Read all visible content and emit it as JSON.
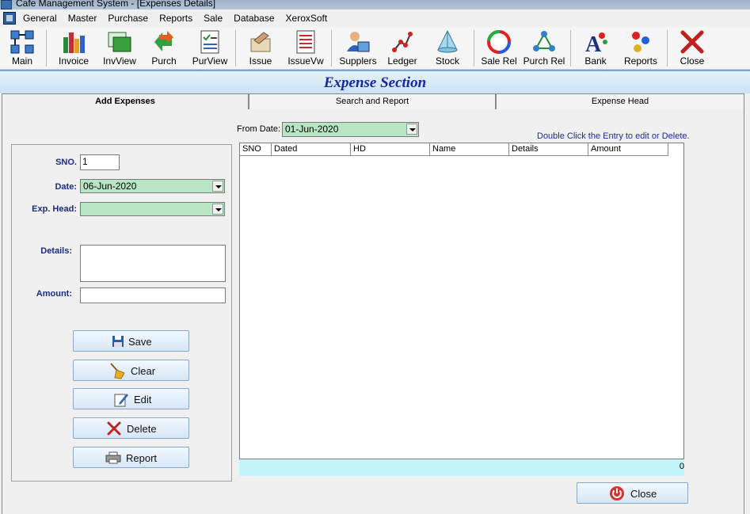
{
  "window": {
    "title": "Cafe Management System - [Expenses Details]"
  },
  "menu": [
    "General",
    "Master",
    "Purchase",
    "Reports",
    "Sale",
    "Database",
    "XeroxSoft"
  ],
  "toolbar": [
    {
      "label": "Main",
      "icon": "main-icon"
    },
    {
      "label": "Invoice",
      "icon": "invoice-icon"
    },
    {
      "label": "InvView",
      "icon": "invview-icon"
    },
    {
      "label": "Purch",
      "icon": "purch-icon"
    },
    {
      "label": "PurView",
      "icon": "purview-icon"
    },
    {
      "label": "Issue",
      "icon": "issue-icon"
    },
    {
      "label": "IssueVw",
      "icon": "issuevw-icon"
    },
    {
      "label": "Supplers",
      "icon": "supplers-icon"
    },
    {
      "label": "Ledger",
      "icon": "ledger-icon"
    },
    {
      "label": "Stock",
      "icon": "stock-icon"
    },
    {
      "label": "Sale Rel",
      "icon": "sale-rel-icon"
    },
    {
      "label": "Purch Rel",
      "icon": "purch-rel-icon"
    },
    {
      "label": "Bank",
      "icon": "bank-icon"
    },
    {
      "label": "Reports",
      "icon": "reports-icon"
    },
    {
      "label": "Close",
      "icon": "close-icon"
    }
  ],
  "section_title": "Expense Section",
  "tabs": [
    "Add Expenses",
    "Search and Report",
    "Expense Head"
  ],
  "form": {
    "sno_label": "SNO.",
    "sno_value": "1",
    "date_label": "Date:",
    "date_value": "06-Jun-2020",
    "head_label": "Exp. Head:",
    "head_value": "",
    "details_label": "Details:",
    "details_value": "",
    "amount_label": "Amount:",
    "amount_value": ""
  },
  "buttons": {
    "save": "Save",
    "clear": "Clear",
    "edit": "Edit",
    "delete": "Delete",
    "report": "Report",
    "close": "Close"
  },
  "filter": {
    "from_label": "From Date:",
    "from_value": "01-Jun-2020"
  },
  "hint": "Double Click the Entry to edit or Delete.",
  "grid": {
    "columns": [
      "SNO",
      "Dated",
      "HD",
      "Name",
      "Details",
      "Amount"
    ],
    "rows": []
  },
  "count": "0",
  "colors": {
    "accent": "#1428a8",
    "combo_bg": "#b8e6c4",
    "count_bg": "#c3f5f9"
  }
}
